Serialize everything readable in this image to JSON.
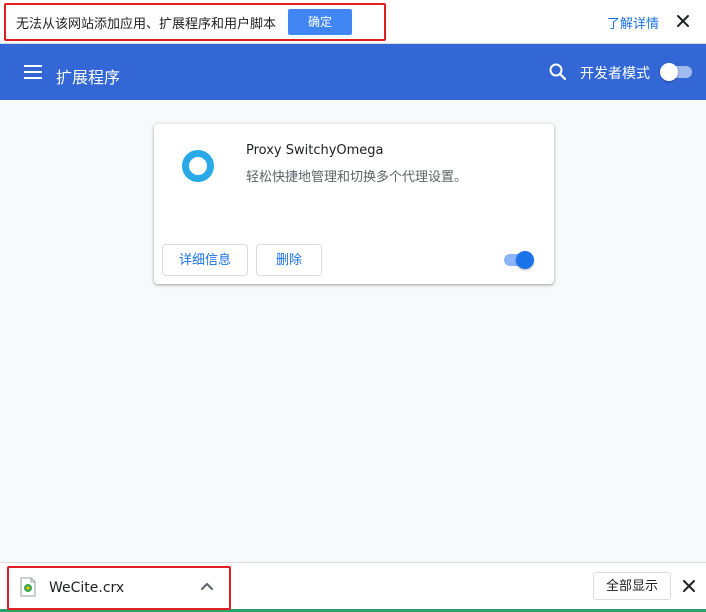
{
  "infobar": {
    "message": "无法从该网站添加应用、扩展程序和用户脚本",
    "ok_label": "确定",
    "learn_more": "了解详情",
    "close_icon": "close-icon"
  },
  "header": {
    "menu_icon": "menu-icon",
    "title": "扩展程序",
    "search_icon": "search-icon",
    "developer_mode_label": "开发者模式",
    "developer_mode_on": false
  },
  "extension": {
    "icon": "switchyomega-ring-icon",
    "name": "Proxy SwitchyOmega",
    "description": "轻松快捷地管理和切换多个代理设置。",
    "details_label": "详细信息",
    "remove_label": "删除",
    "enabled": true
  },
  "download_shelf": {
    "file_icon": "crx-file-icon",
    "file_name": "WeCite.crx",
    "expand_icon": "chevron-up-icon",
    "show_all_label": "全部显示",
    "close_icon": "close-icon"
  },
  "colors": {
    "header_bg": "#3367d6",
    "accent": "#1a73e8",
    "ok_button": "#4285f4",
    "highlight_box": "#e02020",
    "extension_icon": "#29a9e8"
  }
}
